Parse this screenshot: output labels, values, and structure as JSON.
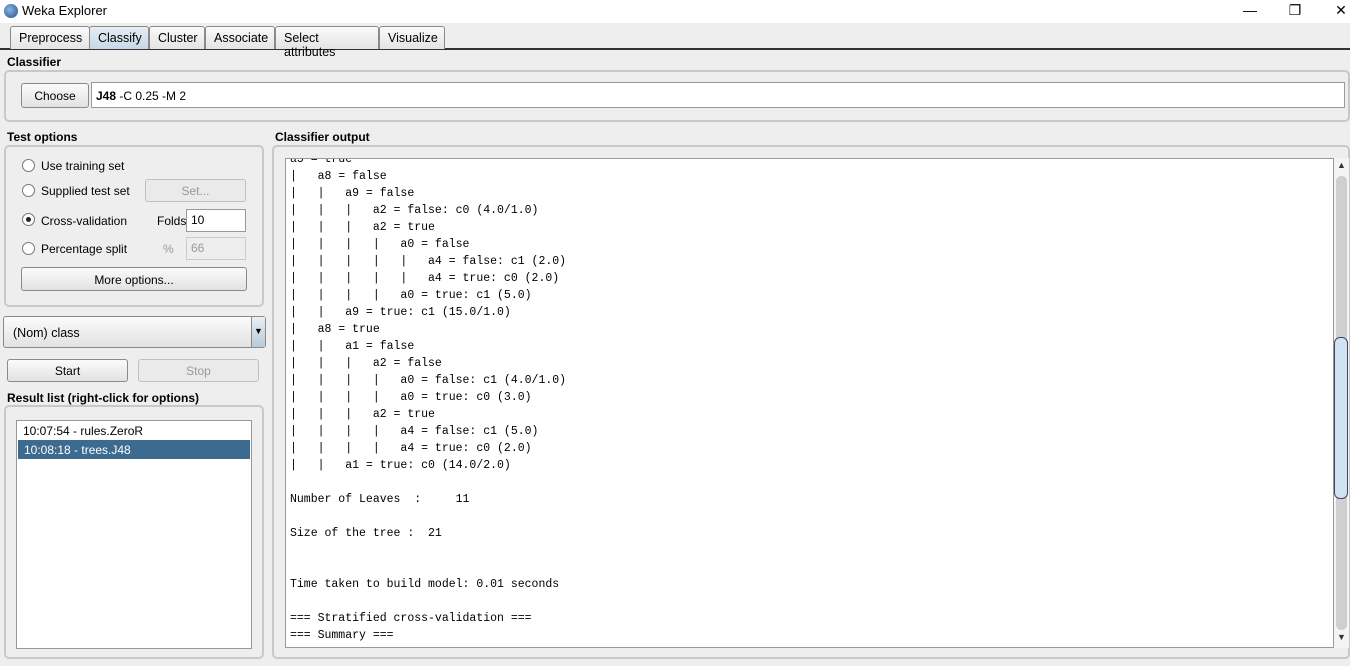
{
  "window": {
    "title": "Weka Explorer",
    "minimize": "—",
    "restore": "❐",
    "close": "✕"
  },
  "tabs": [
    {
      "label": "Preprocess"
    },
    {
      "label": "Classify"
    },
    {
      "label": "Cluster"
    },
    {
      "label": "Associate"
    },
    {
      "label": "Select attributes"
    },
    {
      "label": "Visualize"
    }
  ],
  "classifier": {
    "section": "Classifier",
    "choose": "Choose",
    "name": "J48",
    "options": "-C 0.25 -M 2"
  },
  "test_options": {
    "section": "Test options",
    "use_training": "Use training set",
    "supplied": "Supplied test set",
    "set_button": "Set...",
    "cross_validation": "Cross-validation",
    "folds_label": "Folds",
    "folds_value": "10",
    "percentage_split": "Percentage split",
    "percent_symbol": "%",
    "percent_value": "66",
    "more_options": "More options...",
    "selected": "Cross-validation"
  },
  "class_select": {
    "value": "(Nom) class"
  },
  "actions": {
    "start": "Start",
    "stop": "Stop"
  },
  "result_list": {
    "section": "Result list (right-click for options)",
    "items": [
      {
        "label": "10:07:54 - rules.ZeroR"
      },
      {
        "label": "10:08:18 - trees.J48",
        "selected": true
      }
    ]
  },
  "output": {
    "section": "Classifier output",
    "text": "a5 = true\n|   a8 = false\n|   |   a9 = false\n|   |   |   a2 = false: c0 (4.0/1.0)\n|   |   |   a2 = true\n|   |   |   |   a0 = false\n|   |   |   |   |   a4 = false: c1 (2.0)\n|   |   |   |   |   a4 = true: c0 (2.0)\n|   |   |   |   a0 = true: c1 (5.0)\n|   |   a9 = true: c1 (15.0/1.0)\n|   a8 = true\n|   |   a1 = false\n|   |   |   a2 = false\n|   |   |   |   a0 = false: c1 (4.0/1.0)\n|   |   |   |   a0 = true: c0 (3.0)\n|   |   |   a2 = true\n|   |   |   |   a4 = false: c1 (5.0)\n|   |   |   |   a4 = true: c0 (2.0)\n|   |   a1 = true: c0 (14.0/2.0)\n\nNumber of Leaves  : \t11\n\nSize of the tree : \t21\n\n\nTime taken to build model: 0.01 seconds\n\n=== Stratified cross-validation ===\n=== Summary ===",
    "scroll_position": 0.55
  },
  "colors": {
    "selection": "#3d6a8f",
    "tab_selected": "#c8d8e6",
    "scroll_thumb": "#cfe3f3"
  }
}
